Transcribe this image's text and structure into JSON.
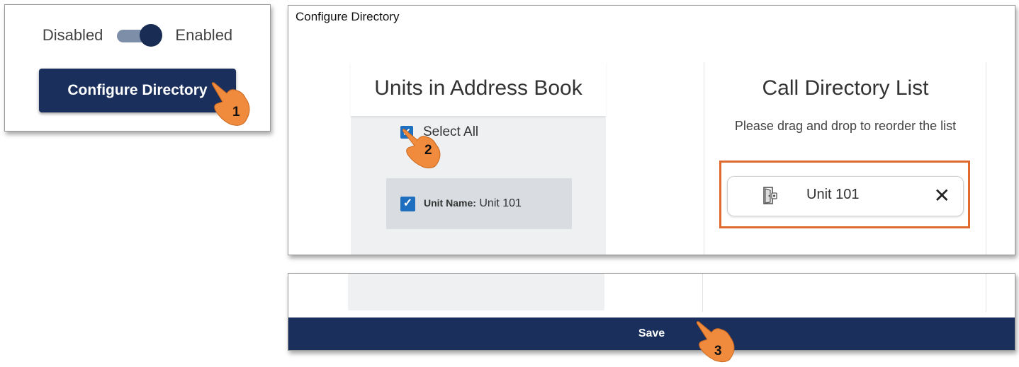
{
  "toggle": {
    "off_label": "Disabled",
    "on_label": "Enabled",
    "state": "on"
  },
  "configure_button": {
    "label": "Configure Directory"
  },
  "dialog": {
    "title": "Configure Directory",
    "left_column": {
      "heading": "Units in Address Book",
      "select_all_label": "Select All",
      "select_all_checked": true,
      "units": [
        {
          "field_label": "Unit Name:",
          "value": "Unit 101",
          "checked": true
        }
      ]
    },
    "right_column": {
      "heading": "Call Directory List",
      "instructions": "Please drag and drop to reorder the list",
      "items": [
        {
          "icon": "door-icon",
          "name": "Unit 101",
          "remove_glyph": "✕"
        }
      ]
    }
  },
  "footer": {
    "save_label": "Save"
  },
  "steps": [
    "1",
    "2",
    "3"
  ],
  "colors": {
    "navy": "#1a2f5c",
    "accent": "#e06a2e",
    "checkbox": "#1f6fc0",
    "hand": "#f08a3c"
  }
}
